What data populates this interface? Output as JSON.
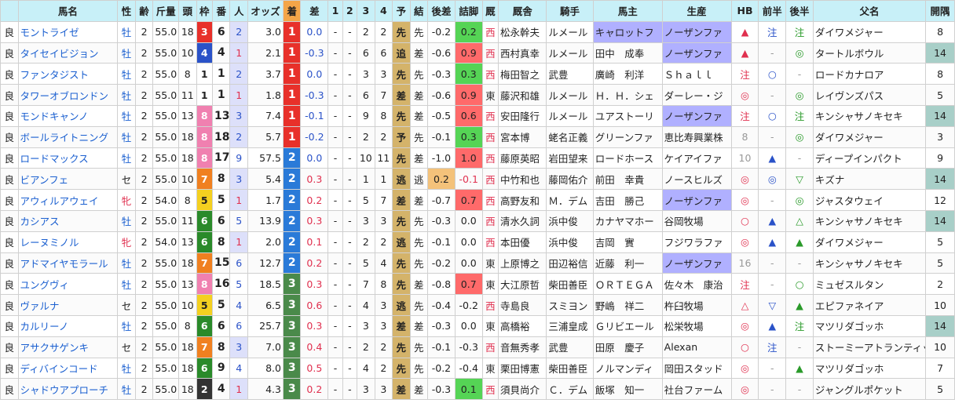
{
  "header": [
    "馬名",
    "性",
    "齢",
    "斤量",
    "頭",
    "枠",
    "番",
    "人",
    "オッズ",
    "着",
    "差",
    "1",
    "2",
    "3",
    "4",
    "予",
    "結",
    "後差",
    "詰脚",
    "厩",
    "厩舎",
    "騎手",
    "馬主",
    "生産",
    "HB",
    "前半",
    "後半",
    "父名",
    "開隅"
  ],
  "waku_colors": {
    "1": "#ffffff",
    "2": "#333333",
    "3": "#e8302a",
    "4": "#2a52c8",
    "5": "#f4d020",
    "6": "#2a8a2a",
    "7": "#f08020",
    "8": "#f080b0"
  },
  "rows": [
    {
      "cond": "良",
      "name": "モントライゼ",
      "sex": "牡",
      "age": "2",
      "kin": "55.0",
      "heads": "18",
      "waku": "3",
      "ban": "6",
      "pop": "2",
      "odds": "3.0",
      "rank": "1",
      "diff": "0.0",
      "c1": "-",
      "c2": "-",
      "c3": "2",
      "c4": "2",
      "yoso": "先",
      "res": "先",
      "gosa": "-0.2",
      "tsume": "0.2",
      "tsume_hl": "g",
      "stable": "西",
      "trainer": "松永幹夫",
      "jockey": "ルメール",
      "owner": "キャロットフ",
      "owner_hl": true,
      "breeder": "ノーザンファ",
      "breeder_hl": true,
      "hb": "▲",
      "hb_c": "red",
      "front": "注",
      "front_c": "blue",
      "back": "注",
      "back_c": "green",
      "sire": "ダイワメジャー",
      "days": "8",
      "days_hl": false
    },
    {
      "cond": "良",
      "name": "タイセイビジョン",
      "sex": "牡",
      "age": "2",
      "kin": "55.0",
      "heads": "10",
      "waku": "4",
      "ban": "4",
      "pop": "1",
      "odds": "2.1",
      "rank": "1",
      "diff": "-0.3",
      "c1": "-",
      "c2": "-",
      "c3": "6",
      "c4": "6",
      "yoso": "追",
      "res": "差",
      "gosa": "-0.6",
      "tsume": "0.9",
      "tsume_hl": "r",
      "stable": "西",
      "trainer": "西村真幸",
      "jockey": "ルメール",
      "owner": "田中　成奉",
      "owner_hl": false,
      "breeder": "ノーザンファ",
      "breeder_hl": true,
      "hb": "▲",
      "hb_c": "red",
      "front": "-",
      "front_c": "gray",
      "back": "◎",
      "back_c": "green",
      "sire": "タートルボウル",
      "days": "14",
      "days_hl": true
    },
    {
      "cond": "良",
      "name": "ファンタジスト",
      "sex": "牡",
      "age": "2",
      "kin": "55.0",
      "heads": "8",
      "waku": "1",
      "ban": "1",
      "pop": "2",
      "odds": "3.7",
      "rank": "1",
      "diff": "0.0",
      "c1": "-",
      "c2": "-",
      "c3": "3",
      "c4": "3",
      "yoso": "先",
      "res": "先",
      "gosa": "-0.3",
      "tsume": "0.3",
      "tsume_hl": "g",
      "stable": "西",
      "trainer": "梅田智之",
      "jockey": "武豊",
      "owner": "廣崎　利洋",
      "owner_hl": false,
      "breeder": "Ｓｈａｌｌ",
      "breeder_hl": false,
      "hb": "注",
      "hb_c": "red",
      "front": "○",
      "front_c": "blue",
      "back": "-",
      "back_c": "gray",
      "sire": "ロードカナロア",
      "days": "8",
      "days_hl": false
    },
    {
      "cond": "良",
      "name": "タワーオブロンドン",
      "sex": "牡",
      "age": "2",
      "kin": "55.0",
      "heads": "11",
      "waku": "1",
      "ban": "1",
      "pop": "1",
      "odds": "1.8",
      "rank": "1",
      "diff": "-0.3",
      "c1": "-",
      "c2": "-",
      "c3": "6",
      "c4": "7",
      "yoso": "差",
      "res": "差",
      "gosa": "-0.6",
      "tsume": "0.9",
      "tsume_hl": "r",
      "stable": "東",
      "trainer": "藤沢和雄",
      "jockey": "ルメール",
      "owner": "Ｈ．Ｈ．シェ",
      "owner_hl": false,
      "breeder": "ダーレー・ジ",
      "breeder_hl": false,
      "hb": "◎",
      "hb_c": "red",
      "front": "-",
      "front_c": "gray",
      "back": "◎",
      "back_c": "green",
      "sire": "レイヴンズパス",
      "days": "5",
      "days_hl": false
    },
    {
      "cond": "良",
      "name": "モンドキャンノ",
      "sex": "牡",
      "age": "2",
      "kin": "55.0",
      "heads": "13",
      "waku": "8",
      "ban": "13",
      "pop": "3",
      "odds": "7.4",
      "rank": "1",
      "diff": "-0.1",
      "c1": "-",
      "c2": "-",
      "c3": "9",
      "c4": "8",
      "yoso": "先",
      "res": "差",
      "gosa": "-0.5",
      "tsume": "0.6",
      "tsume_hl": "r",
      "stable": "西",
      "trainer": "安田隆行",
      "jockey": "ルメール",
      "owner": "ユアストーリ",
      "owner_hl": false,
      "breeder": "ノーザンファ",
      "breeder_hl": true,
      "hb": "注",
      "hb_c": "red",
      "front": "○",
      "front_c": "blue",
      "back": "注",
      "back_c": "green",
      "sire": "キンシャサノキセキ",
      "days": "14",
      "days_hl": true
    },
    {
      "cond": "良",
      "name": "ボールライトニング",
      "sex": "牡",
      "age": "2",
      "kin": "55.0",
      "heads": "18",
      "waku": "8",
      "ban": "18",
      "pop": "2",
      "odds": "5.7",
      "rank": "1",
      "diff": "-0.2",
      "c1": "-",
      "c2": "-",
      "c3": "2",
      "c4": "2",
      "yoso": "予",
      "res": "先",
      "gosa": "-0.1",
      "tsume": "0.3",
      "tsume_hl": "g",
      "stable": "西",
      "trainer": "宮本博",
      "jockey": "蛯名正義",
      "owner": "グリーンファ",
      "owner_hl": false,
      "breeder": "恵比寿興業株",
      "breeder_hl": false,
      "hb": "8",
      "hb_c": "gray",
      "front": "-",
      "front_c": "gray",
      "back": "◎",
      "back_c": "green",
      "sire": "ダイワメジャー",
      "days": "3",
      "days_hl": false
    },
    {
      "cond": "良",
      "name": "ロードマックス",
      "sex": "牡",
      "age": "2",
      "kin": "55.0",
      "heads": "18",
      "waku": "8",
      "ban": "17",
      "pop": "9",
      "odds": "57.5",
      "rank": "2",
      "diff": "0.0",
      "c1": "-",
      "c2": "-",
      "c3": "10",
      "c4": "11",
      "yoso": "先",
      "res": "差",
      "gosa": "-1.0",
      "tsume": "1.0",
      "tsume_hl": "r",
      "stable": "西",
      "trainer": "藤原英昭",
      "jockey": "岩田望来",
      "owner": "ロードホース",
      "owner_hl": false,
      "breeder": "ケイアイファ",
      "breeder_hl": false,
      "hb": "10",
      "hb_c": "gray",
      "front": "▲",
      "front_c": "blue",
      "back": "-",
      "back_c": "gray",
      "sire": "ディープインパクト",
      "days": "9",
      "days_hl": false
    },
    {
      "cond": "良",
      "name": "ビアンフェ",
      "sex": "セ",
      "age": "2",
      "kin": "55.0",
      "heads": "10",
      "waku": "7",
      "ban": "8",
      "pop": "3",
      "odds": "5.4",
      "rank": "2",
      "diff": "0.3",
      "c1": "-",
      "c2": "-",
      "c3": "1",
      "c4": "1",
      "yoso": "逃",
      "res": "逃",
      "gosa": "0.2",
      "tsume": "-0.1",
      "tsume_hl": "o",
      "stable": "西",
      "trainer": "中竹和也",
      "jockey": "藤岡佑介",
      "owner": "前田　幸貴",
      "owner_hl": false,
      "breeder": "ノースヒルズ",
      "breeder_hl": false,
      "hb": "◎",
      "hb_c": "red",
      "front": "◎",
      "front_c": "blue",
      "back": "▽",
      "back_c": "green",
      "sire": "キズナ",
      "days": "14",
      "days_hl": true
    },
    {
      "cond": "良",
      "name": "アウィルアウェイ",
      "sex": "牝",
      "age": "2",
      "kin": "54.0",
      "heads": "8",
      "waku": "5",
      "ban": "5",
      "pop": "1",
      "odds": "1.7",
      "rank": "2",
      "diff": "0.2",
      "c1": "-",
      "c2": "-",
      "c3": "5",
      "c4": "7",
      "yoso": "差",
      "res": "差",
      "gosa": "-0.7",
      "tsume": "0.7",
      "tsume_hl": "r",
      "stable": "西",
      "trainer": "高野友和",
      "jockey": "Ｍ．デム",
      "owner": "吉田　勝己",
      "owner_hl": false,
      "breeder": "ノーザンファ",
      "breeder_hl": true,
      "hb": "◎",
      "hb_c": "red",
      "front": "-",
      "front_c": "gray",
      "back": "◎",
      "back_c": "green",
      "sire": "ジャスタウェイ",
      "days": "12",
      "days_hl": false
    },
    {
      "cond": "良",
      "name": "カシアス",
      "sex": "牡",
      "age": "2",
      "kin": "55.0",
      "heads": "11",
      "waku": "6",
      "ban": "6",
      "pop": "5",
      "odds": "13.9",
      "rank": "2",
      "diff": "0.3",
      "c1": "-",
      "c2": "-",
      "c3": "3",
      "c4": "3",
      "yoso": "先",
      "res": "先",
      "gosa": "-0.3",
      "tsume": "0.0",
      "tsume_hl": "none",
      "stable": "西",
      "trainer": "清水久詞",
      "jockey": "浜中俊",
      "owner": "カナヤマホー",
      "owner_hl": false,
      "breeder": "谷岡牧場",
      "breeder_hl": false,
      "hb": "○",
      "hb_c": "red",
      "front": "▲",
      "front_c": "blue",
      "back": "△",
      "back_c": "green",
      "sire": "キンシャサノキセキ",
      "days": "14",
      "days_hl": true
    },
    {
      "cond": "良",
      "name": "レーヌミノル",
      "sex": "牝",
      "age": "2",
      "kin": "54.0",
      "heads": "13",
      "waku": "6",
      "ban": "8",
      "pop": "1",
      "odds": "2.0",
      "rank": "2",
      "diff": "0.1",
      "c1": "-",
      "c2": "-",
      "c3": "2",
      "c4": "2",
      "yoso": "逃",
      "res": "先",
      "gosa": "-0.1",
      "tsume": "0.0",
      "tsume_hl": "none",
      "stable": "西",
      "trainer": "本田優",
      "jockey": "浜中俊",
      "owner": "吉岡　實",
      "owner_hl": false,
      "breeder": "フジワラファ",
      "breeder_hl": false,
      "hb": "◎",
      "hb_c": "red",
      "front": "▲",
      "front_c": "blue",
      "back": "▲",
      "back_c": "green",
      "sire": "ダイワメジャー",
      "days": "5",
      "days_hl": false
    },
    {
      "cond": "良",
      "name": "アドマイヤモラール",
      "sex": "牡",
      "age": "2",
      "kin": "55.0",
      "heads": "18",
      "waku": "7",
      "ban": "15",
      "pop": "6",
      "odds": "12.7",
      "rank": "2",
      "diff": "0.2",
      "c1": "-",
      "c2": "-",
      "c3": "5",
      "c4": "4",
      "yoso": "先",
      "res": "先",
      "gosa": "-0.2",
      "tsume": "0.0",
      "tsume_hl": "none",
      "stable": "東",
      "trainer": "上原博之",
      "jockey": "田辺裕信",
      "owner": "近藤　利一",
      "owner_hl": false,
      "breeder": "ノーザンファ",
      "breeder_hl": true,
      "hb": "16",
      "hb_c": "gray",
      "front": "-",
      "front_c": "gray",
      "back": "-",
      "back_c": "gray",
      "sire": "キンシャサノキセキ",
      "days": "5",
      "days_hl": false
    },
    {
      "cond": "良",
      "name": "ユングヴィ",
      "sex": "牡",
      "age": "2",
      "kin": "55.0",
      "heads": "13",
      "waku": "8",
      "ban": "16",
      "pop": "5",
      "odds": "18.5",
      "rank": "3",
      "diff": "0.3",
      "c1": "-",
      "c2": "-",
      "c3": "7",
      "c4": "8",
      "yoso": "先",
      "res": "差",
      "gosa": "-0.8",
      "tsume": "0.7",
      "tsume_hl": "r",
      "stable": "東",
      "trainer": "大江原哲",
      "jockey": "柴田善臣",
      "owner": "ＯＲＴＥＧＡ",
      "owner_hl": false,
      "breeder": "佐々木　康治",
      "breeder_hl": false,
      "hb": "注",
      "hb_c": "red",
      "front": "-",
      "front_c": "gray",
      "back": "○",
      "back_c": "green",
      "sire": "ミュゼスルタン",
      "days": "2",
      "days_hl": false
    },
    {
      "cond": "良",
      "name": "ヴァルナ",
      "sex": "セ",
      "age": "2",
      "kin": "55.0",
      "heads": "10",
      "waku": "5",
      "ban": "5",
      "pop": "4",
      "odds": "6.5",
      "rank": "3",
      "diff": "0.6",
      "c1": "-",
      "c2": "-",
      "c3": "4",
      "c4": "3",
      "yoso": "逃",
      "res": "先",
      "gosa": "-0.4",
      "tsume": "-0.2",
      "tsume_hl": "none",
      "stable": "西",
      "trainer": "寺島良",
      "jockey": "スミヨン",
      "owner": "野嶋　祥二",
      "owner_hl": false,
      "breeder": "杵臼牧場",
      "breeder_hl": false,
      "hb": "△",
      "hb_c": "red",
      "front": "▽",
      "front_c": "blue",
      "back": "▲",
      "back_c": "green",
      "sire": "エピファネイア",
      "days": "10",
      "days_hl": false
    },
    {
      "cond": "良",
      "name": "カルリーノ",
      "sex": "牡",
      "age": "2",
      "kin": "55.0",
      "heads": "8",
      "waku": "6",
      "ban": "6",
      "pop": "6",
      "odds": "25.7",
      "rank": "3",
      "diff": "0.3",
      "c1": "-",
      "c2": "-",
      "c3": "3",
      "c4": "3",
      "yoso": "差",
      "res": "差",
      "gosa": "-0.3",
      "tsume": "0.0",
      "tsume_hl": "none",
      "stable": "東",
      "trainer": "高橋裕",
      "jockey": "三浦皇成",
      "owner": "Ｇリビエール",
      "owner_hl": false,
      "breeder": "松栄牧場",
      "breeder_hl": false,
      "hb": "◎",
      "hb_c": "red",
      "front": "▲",
      "front_c": "blue",
      "back": "注",
      "back_c": "green",
      "sire": "マツリダゴッホ",
      "days": "14",
      "days_hl": true
    },
    {
      "cond": "良",
      "name": "アサクサゲンキ",
      "sex": "セ",
      "age": "2",
      "kin": "55.0",
      "heads": "18",
      "waku": "7",
      "ban": "8",
      "pop": "3",
      "odds": "7.0",
      "rank": "3",
      "diff": "0.4",
      "c1": "-",
      "c2": "-",
      "c3": "2",
      "c4": "2",
      "yoso": "先",
      "res": "先",
      "gosa": "-0.1",
      "tsume": "-0.3",
      "tsume_hl": "none",
      "stable": "西",
      "trainer": "音無秀孝",
      "jockey": "武豊",
      "owner": "田原　慶子",
      "owner_hl": false,
      "breeder": "Alexan",
      "breeder_hl": false,
      "hb": "○",
      "hb_c": "red",
      "front": "注",
      "front_c": "blue",
      "back": "-",
      "back_c": "gray",
      "sire": "ストーミーアトランティック",
      "days": "10",
      "days_hl": false
    },
    {
      "cond": "良",
      "name": "ディバインコード",
      "sex": "牡",
      "age": "2",
      "kin": "55.0",
      "heads": "18",
      "waku": "6",
      "ban": "9",
      "pop": "4",
      "odds": "8.0",
      "rank": "3",
      "diff": "0.5",
      "c1": "-",
      "c2": "-",
      "c3": "4",
      "c4": "2",
      "yoso": "先",
      "res": "先",
      "gosa": "-0.2",
      "tsume": "-0.4",
      "tsume_hl": "none",
      "stable": "東",
      "trainer": "栗田博憲",
      "jockey": "柴田善臣",
      "owner": "ノルマンディ",
      "owner_hl": false,
      "breeder": "岡田スタッド",
      "breeder_hl": false,
      "hb": "◎",
      "hb_c": "red",
      "front": "-",
      "front_c": "gray",
      "back": "▲",
      "back_c": "green",
      "sire": "マツリダゴッホ",
      "days": "7",
      "days_hl": false
    },
    {
      "cond": "良",
      "name": "シャドウアプローチ",
      "sex": "牡",
      "age": "2",
      "kin": "55.0",
      "heads": "18",
      "waku": "2",
      "ban": "4",
      "pop": "1",
      "odds": "4.3",
      "rank": "3",
      "diff": "0.2",
      "c1": "-",
      "c2": "-",
      "c3": "3",
      "c4": "3",
      "yoso": "差",
      "res": "差",
      "gosa": "-0.3",
      "tsume": "0.1",
      "tsume_hl": "g",
      "stable": "西",
      "trainer": "須貝尚介",
      "jockey": "Ｃ．デム",
      "owner": "飯塚　知一",
      "owner_hl": false,
      "breeder": "社台ファーム",
      "breeder_hl": false,
      "hb": "◎",
      "hb_c": "red",
      "front": "-",
      "front_c": "gray",
      "back": "-",
      "back_c": "gray",
      "sire": "ジャングルポケット",
      "days": "5",
      "days_hl": false
    }
  ]
}
